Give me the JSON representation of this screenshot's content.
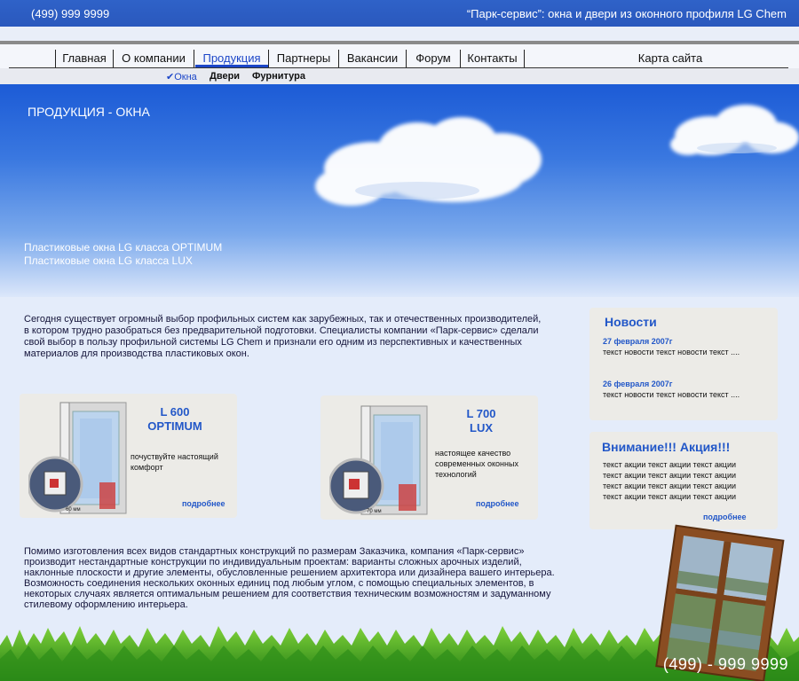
{
  "header": {
    "phone": "(499) 999 9999",
    "tagline": "“Парк-сервис”: окна и двери из оконного профиля LG Chem"
  },
  "nav": {
    "items": [
      "Главная",
      "О компании",
      "Продукция",
      "Партнеры",
      "Вакансии",
      "Форум",
      "Контакты"
    ],
    "active": "Продукция",
    "sitemap": "Карта сайта"
  },
  "subnav": {
    "items": [
      "✔Окна",
      "Двери",
      "Фурнитура"
    ],
    "active": "✔Окна"
  },
  "hero": {
    "title": "ПРОДУКЦИЯ - ОКНА",
    "links": [
      "Пластиковые окна LG класса OPTIMUM",
      "Пластиковые окна LG класса LUX"
    ]
  },
  "intro": "Сегодня существует огромный выбор профильных систем как зарубежных, так и отечественных производителей, в котором трудно разобраться без предварительной подготовки. Специалисты компании «Парк-сервис» сделали свой выбор в пользу профильной системы LG Chem и признали его одним из перспективных и качественных материалов для производства пластиковых окон.",
  "products": [
    {
      "title_line1": "L 600",
      "title_line2": "OPTIMUM",
      "desc": "почуствуйте настоящий комфорт",
      "more": "подробнее",
      "dim_label": "60 мм"
    },
    {
      "title_line1": "L 700",
      "title_line2": "LUX",
      "desc": "настоящее качество современных оконных технологий",
      "more": "подробнее",
      "dim_label": "70 мм"
    }
  ],
  "news": {
    "title": "Новости",
    "items": [
      {
        "date": "27 февраля 2007г",
        "text": "текст новости текст новости текст ...."
      },
      {
        "date": "26 февраля 2007г",
        "text": "текст новости текст новости текст ...."
      }
    ]
  },
  "promo": {
    "title": "Внимание!!! Акция!!!",
    "lines": [
      "текст акции текст акции текст акции",
      "текст акции текст акции текст акции",
      "текст акции текст акции текст акции",
      "текст акции текст акции текст акции"
    ],
    "more": "подробнее"
  },
  "bottom_text": "Помимо изготовления всех видов стандартных конструкций по размерам Заказчика, компания «Парк-сервис» производит нестандартные конструкции по индивидуальным проектам: варианты сложных арочных изделий, наклонные плоскости и другие элементы, обусловленные решением архитектора или дизайнера вашего интерьера. Возможность соединения нескольких оконных единиц под любым углом, с помощью специальных элементов, в некоторых случаях является оптимальным решением для соответствия техническим возможностям и задуманному стилевому оформлению интерьера.",
  "footer": {
    "phone": "(499) - 999 9999"
  },
  "colors": {
    "header_blue": "#2f62c8",
    "link_blue": "#2257c8",
    "panel_bg": "#ecebe7"
  }
}
